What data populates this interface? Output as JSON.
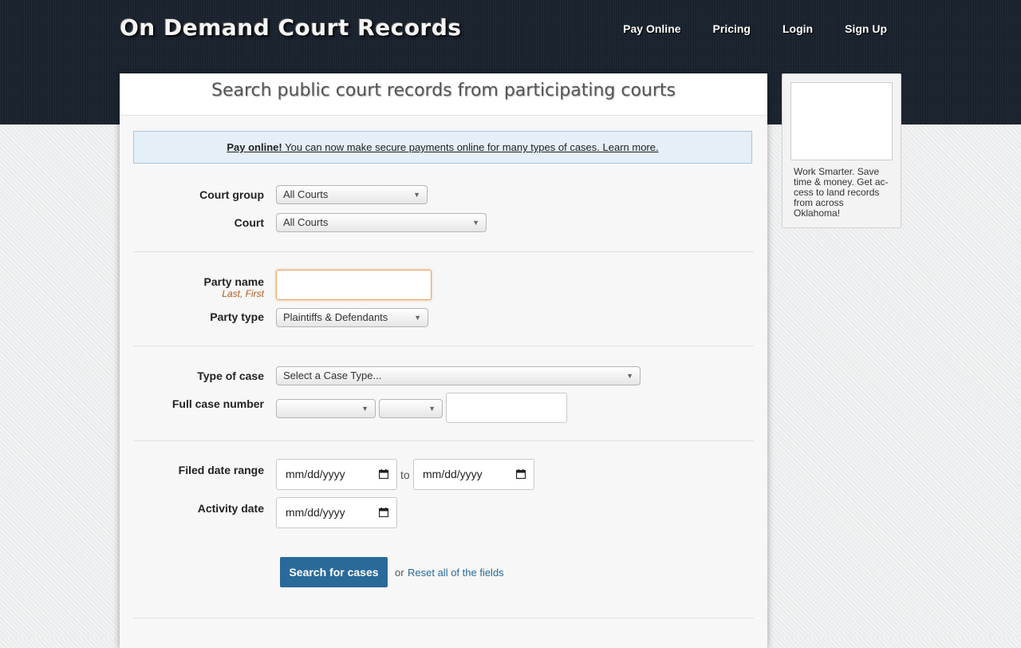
{
  "header": {
    "logo": "On Demand Court Records",
    "nav": [
      "Pay Online",
      "Pricing",
      "Login",
      "Sign Up"
    ]
  },
  "panel": {
    "title": "Search public court records from participating courts",
    "notice": {
      "strong": "Pay online!",
      "text": " You can now make secure payments online for many types of cases. Learn more."
    }
  },
  "form": {
    "court_group": {
      "label": "Court group",
      "value": "All Courts"
    },
    "court": {
      "label": "Court",
      "value": "All Courts"
    },
    "party_name": {
      "label": "Party name",
      "hint": "Last, First",
      "value": ""
    },
    "party_type": {
      "label": "Party type",
      "value": "Plaintiffs & Defendants"
    },
    "case_type": {
      "label": "Type of case",
      "value": "Select a Case Type..."
    },
    "case_number": {
      "label": "Full case number",
      "part1": "",
      "part2": "",
      "part3": ""
    },
    "filed_date": {
      "label": "Filed date range",
      "from": "mm/dd/yyyy",
      "to_word": "to",
      "to": "mm/dd/yyyy"
    },
    "activity_date": {
      "label": "Activity date",
      "value": "mm/dd/yyyy"
    },
    "search_button": "Search for cases",
    "or_word": "or",
    "reset_link": "Reset all of the fields"
  },
  "ad": {
    "text": "Work Smarter. Save time & money. Get ac-cess to land records from across Oklahoma!"
  },
  "colors": {
    "header_bg": "#17202b",
    "button_bg": "#2a6a9a",
    "link": "#2a6a9a",
    "hint": "#b35a1f",
    "notice_bg": "#e4eff7"
  },
  "icons": {
    "select_arrow": "triangle-down",
    "calendar": "calendar-icon"
  }
}
